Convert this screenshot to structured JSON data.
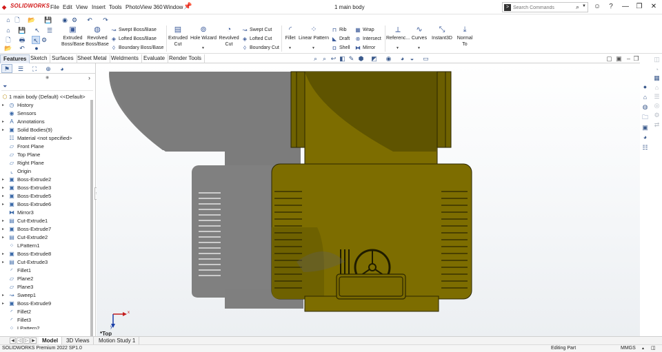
{
  "app": {
    "brand": "SOLIDWORKS",
    "document_title": "1 main body"
  },
  "menu": [
    "File",
    "Edit",
    "View",
    "Insert",
    "Tools",
    "PhotoView 360",
    "Window"
  ],
  "search": {
    "placeholder": "Search Commands"
  },
  "command_manager": {
    "big_buttons": [
      {
        "line1": "Extruded",
        "line2": "Boss/Base",
        "icon": "extruded-boss-icon"
      },
      {
        "line1": "Revolved",
        "line2": "Boss/Base",
        "icon": "revolved-boss-icon"
      },
      {
        "line1": "Extruded",
        "line2": "Cut",
        "icon": "extruded-cut-icon"
      },
      {
        "line1": "Hole Wizard",
        "line2": "",
        "icon": "hole-wizard-icon"
      },
      {
        "line1": "Revolved",
        "line2": "Cut",
        "icon": "revolved-cut-icon"
      },
      {
        "line1": "Fillet",
        "line2": "",
        "icon": "fillet-icon"
      },
      {
        "line1": "Linear Pattern",
        "line2": "",
        "icon": "linear-pattern-icon"
      },
      {
        "line1": "Referenc...",
        "line2": "",
        "icon": "reference-geometry-icon"
      },
      {
        "line1": "Curves",
        "line2": "",
        "icon": "curves-icon"
      },
      {
        "line1": "Instant3D",
        "line2": "",
        "icon": "instant3d-icon"
      },
      {
        "line1": "Normal",
        "line2": "To",
        "icon": "normal-to-icon"
      }
    ],
    "small_buttons": {
      "boss": [
        "Swept Boss/Base",
        "Lofted Boss/Base",
        "Boundary Boss/Base"
      ],
      "cut": [
        "Swept Cut",
        "Lofted Cut",
        "Boundary Cut"
      ],
      "features": [
        "Rib",
        "Draft",
        "Shell"
      ],
      "more": [
        "Wrap",
        "Intersect",
        "Mirror"
      ]
    }
  },
  "tabs": [
    "Features",
    "Sketch",
    "Surfaces",
    "Sheet Metal",
    "Weldments",
    "Evaluate",
    "Render Tools"
  ],
  "active_tab": "Features",
  "tree": {
    "root": "1 main body (Default) <<Default>",
    "items": [
      {
        "label": "History",
        "icon": "history-icon",
        "expand": true
      },
      {
        "label": "Sensors",
        "icon": "sensors-icon",
        "expand": false
      },
      {
        "label": "Annotations",
        "icon": "annotations-icon",
        "expand": true
      },
      {
        "label": "Solid Bodies(9)",
        "icon": "solid-bodies-icon",
        "expand": true
      },
      {
        "label": "Material <not specified>",
        "icon": "material-icon",
        "expand": false
      },
      {
        "label": "Front Plane",
        "icon": "plane-icon",
        "expand": false
      },
      {
        "label": "Top Plane",
        "icon": "plane-icon",
        "expand": false
      },
      {
        "label": "Right Plane",
        "icon": "plane-icon",
        "expand": false
      },
      {
        "label": "Origin",
        "icon": "origin-icon",
        "expand": false
      },
      {
        "label": "Boss-Extrude2",
        "icon": "boss-extrude-icon",
        "expand": true
      },
      {
        "label": "Boss-Extrude3",
        "icon": "boss-extrude-icon",
        "expand": true
      },
      {
        "label": "Boss-Extrude5",
        "icon": "boss-extrude-icon",
        "expand": true
      },
      {
        "label": "Boss-Extrude6",
        "icon": "boss-extrude-icon",
        "expand": true
      },
      {
        "label": "Mirror3",
        "icon": "mirror-icon",
        "expand": false
      },
      {
        "label": "Cut-Extrude1",
        "icon": "cut-extrude-icon",
        "expand": true
      },
      {
        "label": "Boss-Extrude7",
        "icon": "boss-extrude-icon",
        "expand": true
      },
      {
        "label": "Cut-Extrude2",
        "icon": "cut-extrude-icon",
        "expand": true
      },
      {
        "label": "LPattern1",
        "icon": "linear-pattern-icon",
        "expand": false
      },
      {
        "label": "Boss-Extrude8",
        "icon": "boss-extrude-icon",
        "expand": true
      },
      {
        "label": "Cut-Extrude3",
        "icon": "cut-extrude-icon",
        "expand": true
      },
      {
        "label": "Fillet1",
        "icon": "fillet-icon",
        "expand": false
      },
      {
        "label": "Plane2",
        "icon": "plane-icon",
        "expand": false
      },
      {
        "label": "Plane3",
        "icon": "plane-icon",
        "expand": false
      },
      {
        "label": "Sweep1",
        "icon": "sweep-icon",
        "expand": true
      },
      {
        "label": "Boss-Extrude9",
        "icon": "boss-extrude-icon",
        "expand": true
      },
      {
        "label": "Fillet2",
        "icon": "fillet-icon",
        "expand": false
      },
      {
        "label": "Fillet3",
        "icon": "fillet-icon",
        "expand": false
      },
      {
        "label": "LPattern2",
        "icon": "linear-pattern-icon",
        "expand": false
      }
    ]
  },
  "viewport": {
    "view_label": "*Top",
    "triad_x": "x",
    "triad_y": "y"
  },
  "bottom_tabs": [
    "Model",
    "3D Views",
    "Motion Study 1"
  ],
  "active_bottom_tab": "Model",
  "status": {
    "version": "SOLIDWORKS Premium 2022 SP1.0",
    "mode": "Editing Part",
    "units": "MMGS"
  },
  "colors": {
    "model_body": "#7d6d00",
    "model_edge": "#2b2600",
    "shadow": "#7b7b7b",
    "accent": "#3b5a8c"
  }
}
